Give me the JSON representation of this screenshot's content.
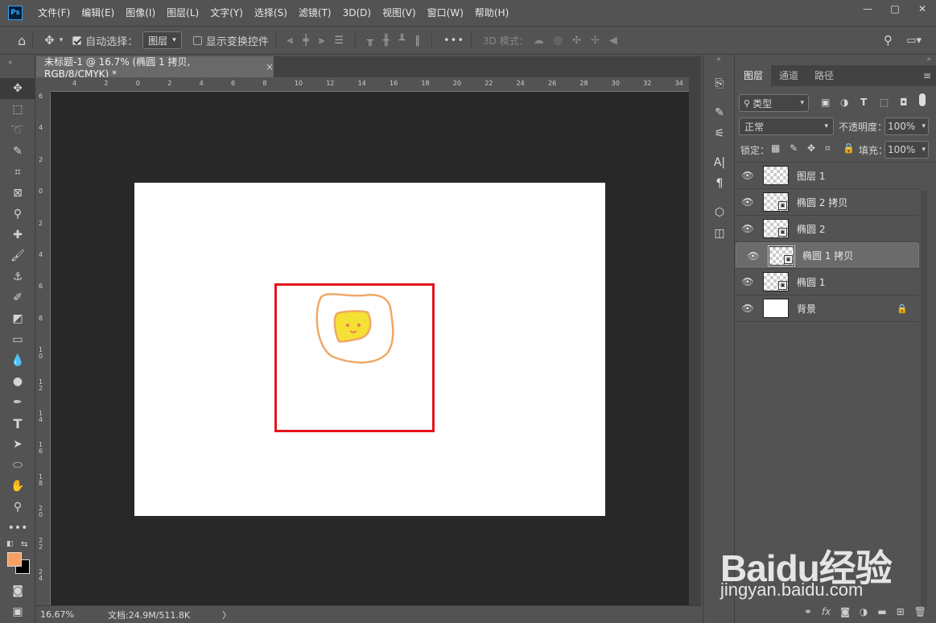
{
  "menubar": {
    "app_icon": "Ps",
    "items": [
      "文件(F)",
      "编辑(E)",
      "图像(I)",
      "图层(L)",
      "文字(Y)",
      "选择(S)",
      "滤镜(T)",
      "3D(D)",
      "视图(V)",
      "窗口(W)",
      "帮助(H)"
    ]
  },
  "optbar": {
    "auto_select_label": "自动选择：",
    "auto_select_value": "图层",
    "show_transform_label": "显示变换控件",
    "more_label": "•••",
    "mode_3d_label": "3D 模式："
  },
  "document": {
    "tab_title": "未标题-1 @ 16.7% (椭圆 1 拷贝, RGB/8/CMYK) *",
    "close_glyph": "×"
  },
  "rulers": {
    "h": [
      "4",
      "2",
      "0",
      "2",
      "4",
      "6",
      "8",
      "10",
      "12",
      "14",
      "16",
      "18",
      "20",
      "22",
      "24",
      "26",
      "28",
      "30",
      "32",
      "34"
    ],
    "v": [
      "6",
      "4",
      "2",
      "0",
      "2",
      "4",
      "6",
      "8",
      "10",
      "12",
      "14",
      "16",
      "18",
      "20",
      "22",
      "24"
    ]
  },
  "status": {
    "zoom": "16.67%",
    "doc_info": "文档:24.9M/511.8K",
    "arrow": "〉"
  },
  "colors": {
    "foreground": "#f6a064",
    "background": "#000000",
    "selection_red": "#e4141c",
    "shape_yellow": "#f5e133",
    "shape_orange": "#f0a868"
  },
  "panel": {
    "tabs": [
      "图层",
      "通道",
      "路径"
    ],
    "filter_kind": "类型",
    "blend_mode": "正常",
    "opacity_label": "不透明度：",
    "opacity_value": "100%",
    "lock_label": "锁定：",
    "fill_label": "填充：",
    "fill_value": "100%",
    "layers": [
      {
        "name": "图层 1",
        "smart": false,
        "selected": false
      },
      {
        "name": "椭圆 2 拷贝",
        "smart": true,
        "selected": false
      },
      {
        "name": "椭圆 2",
        "smart": true,
        "selected": false
      },
      {
        "name": "椭圆 1 拷贝",
        "smart": true,
        "selected": true
      },
      {
        "name": "椭圆 1",
        "smart": true,
        "selected": false
      },
      {
        "name": "背景",
        "smart": false,
        "selected": false,
        "locked": true
      }
    ]
  },
  "watermark": {
    "logo": "Baidu经验",
    "url": "jingyan.baidu.com"
  }
}
